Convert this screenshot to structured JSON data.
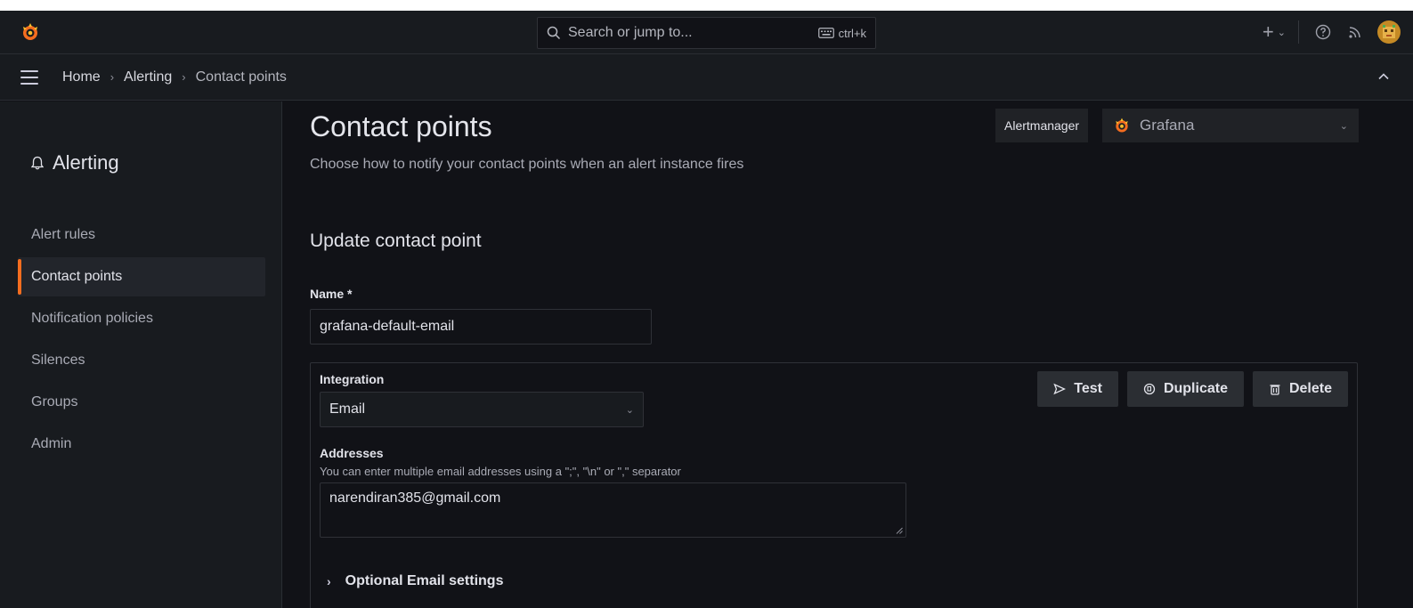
{
  "topbar": {
    "search_placeholder": "Search or jump to...",
    "search_shortcut": "ctrl+k",
    "plus_label": "+",
    "logo_icon": "grafana-logo-icon",
    "brand_color": "#f46d1f"
  },
  "breadcrumb": {
    "items": [
      "Home",
      "Alerting",
      "Contact points"
    ],
    "separator": "›"
  },
  "sidebar": {
    "title": "Alerting",
    "title_icon": "bell-icon",
    "items": [
      {
        "label": "Alert rules",
        "active": false
      },
      {
        "label": "Contact points",
        "active": true
      },
      {
        "label": "Notification policies",
        "active": false
      },
      {
        "label": "Silences",
        "active": false
      },
      {
        "label": "Groups",
        "active": false
      },
      {
        "label": "Admin",
        "active": false
      }
    ]
  },
  "main": {
    "title": "Contact points",
    "subtitle": "Choose how to notify your contact points when an alert instance fires",
    "alertmanager_label": "Alertmanager",
    "alertmanager_value": "Grafana",
    "section_title": "Update contact point",
    "name_label": "Name *",
    "name_value": "grafana-default-email",
    "integration": {
      "label": "Integration",
      "value": "Email",
      "buttons": {
        "test": "Test",
        "duplicate": "Duplicate",
        "delete": "Delete"
      },
      "addresses_label": "Addresses",
      "addresses_help": "You can enter multiple email addresses using a \";\", \"\\n\" or \",\" separator",
      "addresses_value": "narendiran385@gmail.com",
      "optional_settings": "Optional Email settings"
    }
  }
}
